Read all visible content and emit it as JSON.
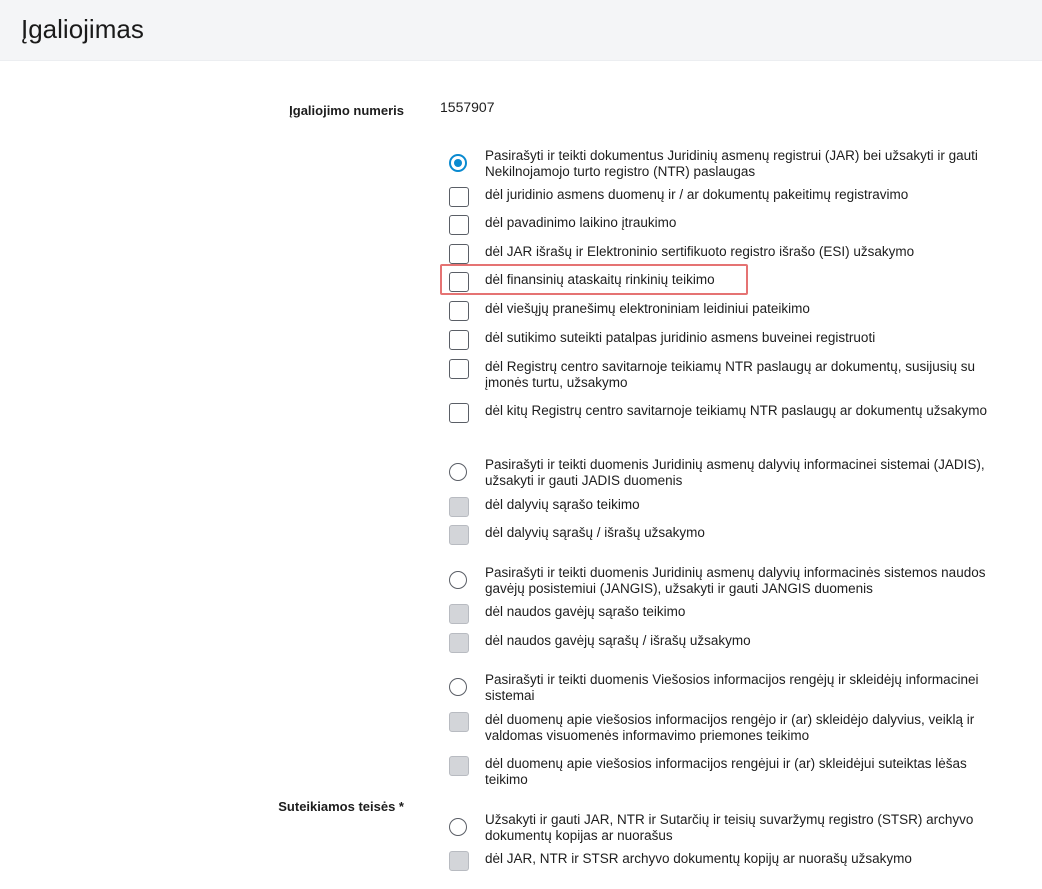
{
  "header": {
    "title": "Įgaliojimas"
  },
  "form": {
    "number_label": "Įgaliojimo numeris",
    "number_value": "1557907",
    "rights_label": "Suteikiamos teisės *"
  },
  "groups": [
    {
      "radio": {
        "label": "Pasirašyti ir teikti dokumentus Juridinių asmenų registrui (JAR) bei užsakyti ir gauti Nekilnojamojo turto registro (NTR) paslaugas",
        "checked": true
      },
      "items": [
        {
          "label": "dėl juridinio asmens duomenų ir / ar dokumentų pakeitimų registravimo"
        },
        {
          "label": "dėl pavadinimo laikino įtraukimo"
        },
        {
          "label": "dėl JAR išrašų ir Elektroninio sertifikuoto registro išrašo (ESI) užsakymo"
        },
        {
          "label": "dėl finansinių ataskaitų rinkinių teikimo",
          "highlighted": true
        },
        {
          "label": "dėl viešųjų pranešimų elektroniniam leidiniui pateikimo"
        },
        {
          "label": "dėl sutikimo suteikti patalpas juridinio asmens buveinei registruoti"
        },
        {
          "label": "dėl Registrų centro savitarnoje teikiamų NTR paslaugų ar dokumentų, susijusių su įmonės turtu, užsakymo"
        },
        {
          "label": "dėl kitų Registrų centro savitarnoje teikiamų NTR paslaugų ar dokumentų užsakymo"
        }
      ]
    },
    {
      "radio": {
        "label": "Pasirašyti ir teikti duomenis Juridinių asmenų dalyvių informacinei sistemai (JADIS), užsakyti ir gauti JADIS duomenis",
        "checked": false
      },
      "items": [
        {
          "label": "dėl dalyvių sąrašo teikimo"
        },
        {
          "label": "dėl dalyvių sąrašų / išrašų užsakymo"
        }
      ]
    },
    {
      "radio": {
        "label": "Pasirašyti ir teikti duomenis Juridinių asmenų dalyvių informacinės sistemos naudos gavėjų posistemiui (JANGIS), užsakyti ir gauti JANGIS duomenis",
        "checked": false
      },
      "items": [
        {
          "label": "dėl naudos gavėjų sąrašo teikimo"
        },
        {
          "label": "dėl naudos gavėjų sąrašų / išrašų užsakymo"
        }
      ]
    },
    {
      "radio": {
        "label": "Pasirašyti ir teikti duomenis Viešosios informacijos rengėjų ir skleidėjų informacinei sistemai",
        "checked": false
      },
      "items": [
        {
          "label": "dėl duomenų apie viešosios informacijos rengėjo ir (ar) skleidėjo dalyvius, veiklą ir valdomas visuomenės informavimo priemones teikimo"
        },
        {
          "label": "dėl duomenų apie viešosios informacijos rengėjui ir (ar) skleidėjui suteiktas lėšas teikimo"
        }
      ]
    },
    {
      "radio": {
        "label": "Užsakyti ir gauti JAR, NTR ir Sutarčių ir teisių suvaržymų registro (STSR) archyvo dokumentų kopijas ar nuorašus",
        "checked": false
      },
      "items": [
        {
          "label": "dėl JAR, NTR ir STSR archyvo dokumentų kopijų ar nuorašų užsakymo"
        }
      ]
    }
  ]
}
